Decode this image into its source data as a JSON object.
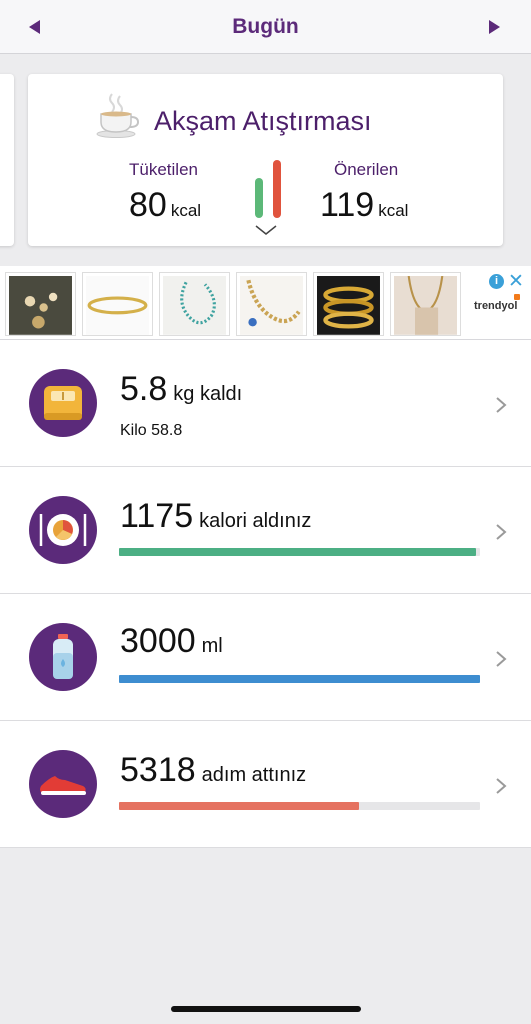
{
  "header": {
    "title": "Bugün",
    "prev_icon": "triangle-left-icon",
    "next_icon": "triangle-right-icon"
  },
  "meal_card": {
    "icon": "teacup-icon",
    "title": "Akşam Atıştırması",
    "consumed_label": "Tüketilen",
    "consumed_value": "80",
    "consumed_unit": "kcal",
    "recommended_label": "Önerilen",
    "recommended_value": "119",
    "recommended_unit": "kcal",
    "colors": {
      "consumed_bar": "#5cb878",
      "recommended_bar": "#e0533d"
    }
  },
  "ad": {
    "brand": "trendyol",
    "info_glyph": "i",
    "close_glyph": "✕",
    "thumbnails": [
      "jewelry-thumb-1",
      "jewelry-thumb-2",
      "jewelry-thumb-3",
      "jewelry-thumb-4",
      "jewelry-thumb-5",
      "jewelry-thumb-6"
    ]
  },
  "rows": [
    {
      "icon": "scale-icon",
      "value": "5.8",
      "suffix": "kg kaldı",
      "sub": "Kilo 58.8"
    },
    {
      "icon": "plate-icon",
      "value": "1175",
      "suffix": "kalori aldınız",
      "progress": 0.99,
      "color": "#4caf84"
    },
    {
      "icon": "water-bottle-icon",
      "value": "3000",
      "suffix": "ml",
      "progress": 1.0,
      "color": "#3d8dd0"
    },
    {
      "icon": "sneaker-icon",
      "value": "5318",
      "suffix": "adım attınız",
      "progress": 0.665,
      "color": "#e57260"
    }
  ]
}
